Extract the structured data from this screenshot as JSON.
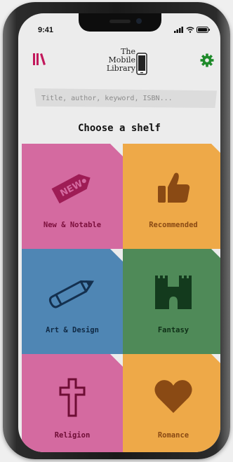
{
  "status": {
    "time": "9:41"
  },
  "logo": {
    "line1": "The",
    "line2": "Mobile",
    "line3": "Library"
  },
  "search": {
    "placeholder": "Title, author, keyword, ISBN..."
  },
  "heading": "Choose a shelf",
  "tag_text": "NEW",
  "colors": {
    "accent": "#c2185b",
    "settings": "#1e8a2a",
    "pink": "#d46aa0",
    "orange": "#eea948",
    "blue": "#4f86b4",
    "green": "#4f8a58"
  },
  "shelves": [
    {
      "label": "New & Notable",
      "icon": "new-tag-icon",
      "color": "#d46aa0"
    },
    {
      "label": "Recommended",
      "icon": "thumbs-up-icon",
      "color": "#eea948"
    },
    {
      "label": "Art & Design",
      "icon": "pencil-icon",
      "color": "#4f86b4"
    },
    {
      "label": "Fantasy",
      "icon": "castle-icon",
      "color": "#4f8a58"
    },
    {
      "label": "Religion",
      "icon": "cross-icon",
      "color": "#d46aa0"
    },
    {
      "label": "Romance",
      "icon": "heart-icon",
      "color": "#eea948"
    }
  ]
}
